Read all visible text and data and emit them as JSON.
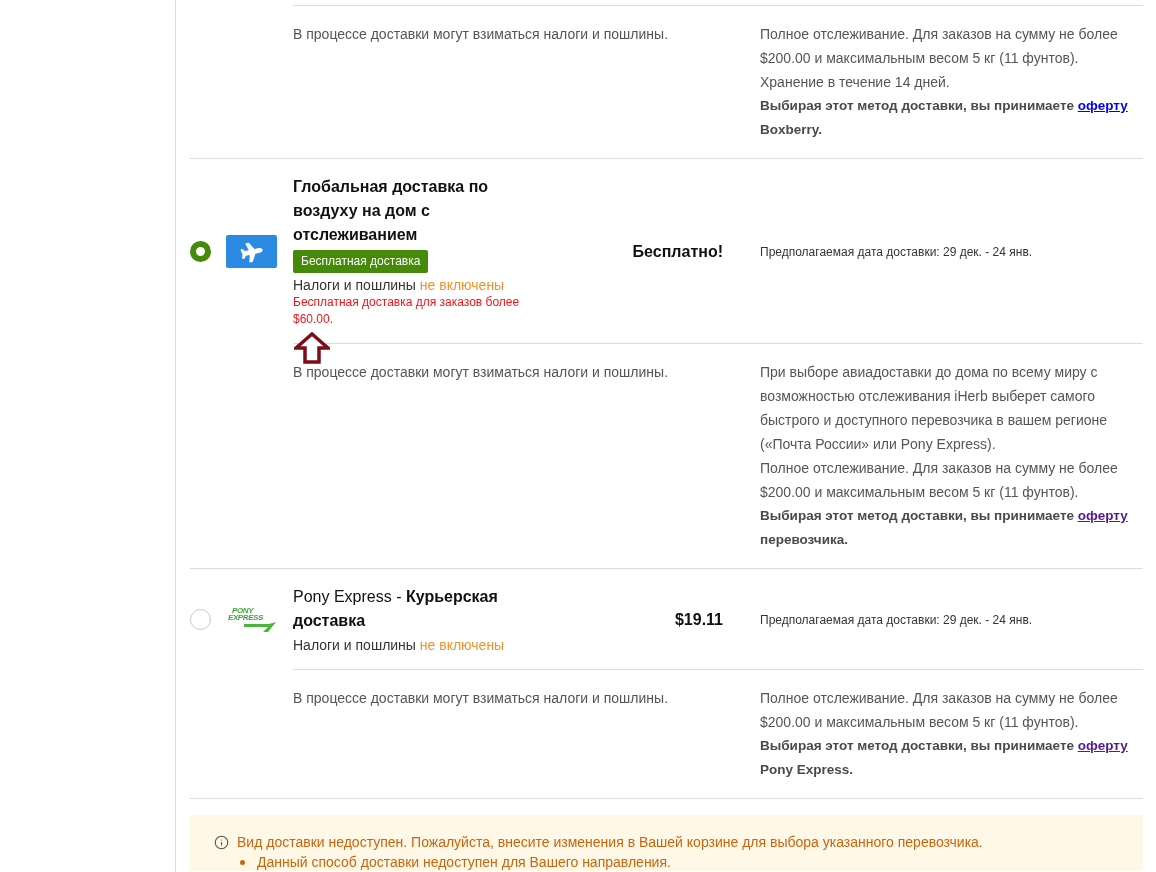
{
  "scrolled_details": {
    "note": "В процессе доставки могут взиматься налоги и пошлины.",
    "paragraphs": [
      "Полное отслеживание. Для заказов на сумму не более $200.00 и максимальным весом 5 кг (11 фунтов).",
      "Хранение в течение 14 дней."
    ],
    "terms": {
      "text": "Выбирая этот метод доставки, вы принимаете",
      "link": "оферту",
      "link_visited": false,
      "tail": "Boxberry."
    }
  },
  "options": [
    {
      "selected": true,
      "pointer_arrow": true,
      "icon": {
        "kind": "plane"
      },
      "title": "Глобальная доставка по воздуху на дом с отслеживанием",
      "badge": "Бесплатная доставка",
      "taxes": {
        "label": "Налоги и пошлины",
        "status": "не включены"
      },
      "promo": "Бесплатная доставка для заказов более $60.00.",
      "price": "Бесплатно!",
      "delivery_estimate": "Предполагаемая дата доставки: 29 дек. - 24 янв.",
      "details": {
        "note": "В процессе доставки могут взиматься налоги и пошлины.",
        "paragraphs": [
          "При выборе авиадоставки до дома по всему миру с возможностью отслеживания iHerb выберет самого быстрого и доступного перевозчика в вашем регионе («Почта России» или Pony Express).",
          "Полное отслеживание. Для заказов на сумму не более $200.00 и максимальным весом 5 кг (11 фунтов)."
        ],
        "terms": {
          "text": "Выбирая этот метод доставки, вы принимаете",
          "link": "оферту",
          "link_visited": true,
          "tail": "перевозчика."
        }
      }
    },
    {
      "selected": false,
      "pointer_arrow": false,
      "icon": {
        "kind": "logo",
        "lines": [
          "PONY",
          "EXPRESS"
        ]
      },
      "carrier": "Pony Express -",
      "title": "Курьерская доставка",
      "taxes": {
        "label": "Налоги и пошлины",
        "status": "не включены"
      },
      "price": "$19.11",
      "delivery_estimate": "Предполагаемая дата доставки: 29 дек. - 24 янв.",
      "details": {
        "note": "В процессе доставки могут взиматься налоги и пошлины.",
        "paragraphs": [
          "Полное отслеживание. Для заказов на сумму не более $200.00 и максимальным весом 5 кг (11 фунтов)."
        ],
        "terms": {
          "text": "Выбирая этот метод доставки, вы принимаете",
          "link": "оферту",
          "link_visited": true,
          "tail": "Pony Express."
        }
      }
    }
  ],
  "notice": {
    "message": "Вид доставки недоступен. Пожалуйста, внесите изменения в Вашей корзине для выбора указанного перевозчика.",
    "items": [
      "Данный способ доставки недоступен для Вашего направления."
    ]
  }
}
